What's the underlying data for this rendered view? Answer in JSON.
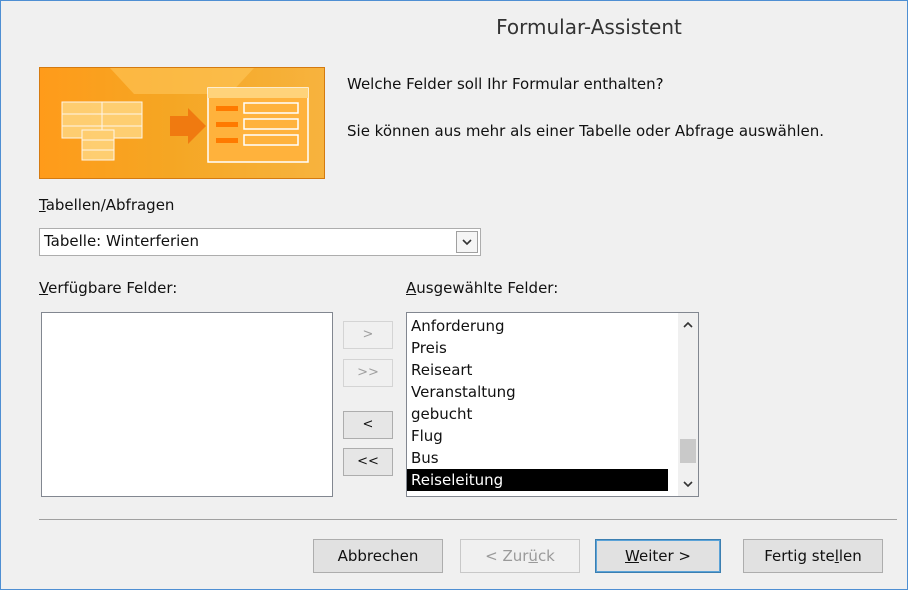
{
  "window": {
    "title": "Formular-Assistent"
  },
  "header": {
    "question": "Welche Felder soll Ihr Formular enthalten?",
    "hint": "Sie können aus mehr als einer Tabelle oder Abfrage auswählen."
  },
  "tables": {
    "label_access": "T",
    "label_rest": "abellen/Abfragen",
    "selected": "Tabelle: Winterferien"
  },
  "available": {
    "label_access": "V",
    "label_rest": "erfügbare Felder:",
    "items": []
  },
  "selected_fields": {
    "label_access": "A",
    "label_rest": "usgewählte Felder:",
    "items": [
      "Anforderung",
      "Preis",
      "Reiseart",
      "Veranstaltung",
      "gebucht",
      "Flug",
      "Bus",
      "Reiseleitung"
    ],
    "selected_item": "Reiseleitung"
  },
  "move_buttons": {
    "add": ">",
    "add_all": ">>",
    "remove": "<",
    "remove_all": "<<"
  },
  "buttons": {
    "cancel": "Abbrechen",
    "back_pre": "< Zur",
    "back_access": "ü",
    "back_post": "ck",
    "next_access": "W",
    "next_post": "eiter >",
    "finish_pre": "Fertig ste",
    "finish_access": "l",
    "finish_post": "len"
  },
  "colors": {
    "accent": "#f5a623",
    "window_border": "#4e8fd3",
    "selection": "#000000"
  }
}
